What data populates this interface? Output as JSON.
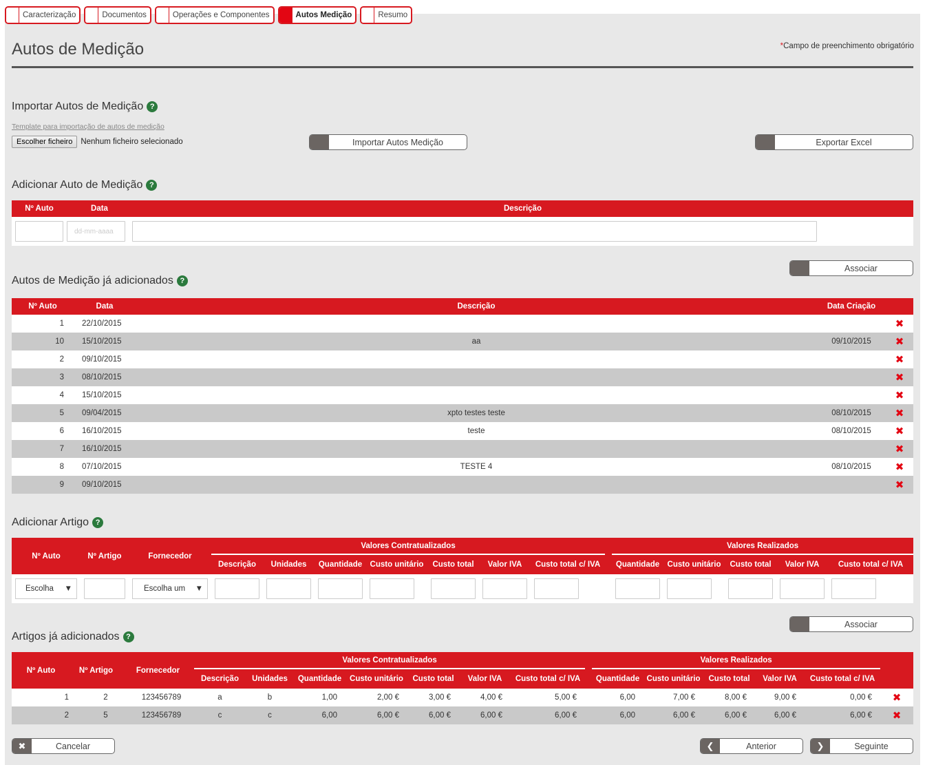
{
  "tabs": [
    {
      "label": "Caracterização",
      "active": false
    },
    {
      "label": "Documentos",
      "active": false
    },
    {
      "label": "Operações e Componentes",
      "active": false
    },
    {
      "label": "Autos Medição",
      "active": true
    },
    {
      "label": "Resumo",
      "active": false
    }
  ],
  "page": {
    "title": "Autos de Medição",
    "required_star": "*",
    "required_note": "Campo de preenchimento obrigatório"
  },
  "import": {
    "title": "Importar Autos de Medição",
    "template_link": "Template para importação de autos de medição",
    "file_button": "Escolher ficheiro",
    "file_status": "Nenhum ficheiro selecionado",
    "import_button": "Importar Autos Medição",
    "export_button": "Exportar Excel"
  },
  "add_auto": {
    "title": "Adicionar Auto de Medição",
    "headers": [
      "Nº Auto",
      "Data",
      "Descrição"
    ],
    "date_placeholder": "dd-mm-aaaa"
  },
  "autos": {
    "title": "Autos de Medição já adicionados",
    "associate_button": "Associar",
    "headers": [
      "Nº Auto",
      "Data",
      "Descrição",
      "Data Criação"
    ],
    "rows": [
      {
        "n": "1",
        "data": "22/10/2015",
        "desc": "",
        "criacao": ""
      },
      {
        "n": "10",
        "data": "15/10/2015",
        "desc": "aa",
        "criacao": "09/10/2015"
      },
      {
        "n": "2",
        "data": "09/10/2015",
        "desc": "",
        "criacao": ""
      },
      {
        "n": "3",
        "data": "08/10/2015",
        "desc": "",
        "criacao": ""
      },
      {
        "n": "4",
        "data": "15/10/2015",
        "desc": "",
        "criacao": ""
      },
      {
        "n": "5",
        "data": "09/04/2015",
        "desc": "xpto testes teste",
        "criacao": "08/10/2015"
      },
      {
        "n": "6",
        "data": "16/10/2015",
        "desc": "teste",
        "criacao": "08/10/2015"
      },
      {
        "n": "7",
        "data": "16/10/2015",
        "desc": "",
        "criacao": ""
      },
      {
        "n": "8",
        "data": "07/10/2015",
        "desc": "TESTE 4",
        "criacao": "08/10/2015"
      },
      {
        "n": "9",
        "data": "09/10/2015",
        "desc": "",
        "criacao": ""
      }
    ],
    "delete_glyph": "✖"
  },
  "add_artigo": {
    "title": "Adicionar Artigo",
    "group_contract": "Valores Contratualizados",
    "group_realized": "Valores Realizados",
    "headers_main": [
      "Nº Auto",
      "Nº Artigo",
      "Fornecedor"
    ],
    "headers_contract": [
      "Descrição",
      "Unidades",
      "Quantidade",
      "Custo unitário",
      "Custo total",
      "Valor IVA",
      "Custo total c/ IVA"
    ],
    "headers_realized": [
      "Quantidade",
      "Custo unitário",
      "Custo total",
      "Valor IVA",
      "Custo total c/ IVA"
    ],
    "select_auto": "Escolha",
    "select_fornecedor": "Escolha um"
  },
  "artigos": {
    "title": "Artigos já adicionados",
    "associate_button": "Associar",
    "group_contract": "Valores Contratualizados",
    "group_realized": "Valores Realizados",
    "headers_main": [
      "Nº Auto",
      "Nº Artigo",
      "Fornecedor"
    ],
    "headers_contract": [
      "Descrição",
      "Unidades",
      "Quantidade",
      "Custo unitário",
      "Custo total",
      "Valor IVA",
      "Custo total c/ IVA"
    ],
    "headers_realized": [
      "Quantidade",
      "Custo unitário",
      "Custo total",
      "Valor IVA",
      "Custo total c/ IVA"
    ],
    "rows": [
      {
        "auto": "1",
        "artigo": "2",
        "fornecedor": "123456789",
        "c": [
          "a",
          "b",
          "1,00",
          "2,00 €",
          "3,00 €",
          "4,00 €",
          "5,00 €"
        ],
        "r": [
          "6,00",
          "7,00 €",
          "8,00 €",
          "9,00 €",
          "0,00 €"
        ]
      },
      {
        "auto": "2",
        "artigo": "5",
        "fornecedor": "123456789",
        "c": [
          "c",
          "c",
          "6,00",
          "6,00 €",
          "6,00 €",
          "6,00 €",
          "6,00 €"
        ],
        "r": [
          "6,00",
          "6,00 €",
          "6,00 €",
          "6,00 €",
          "6,00 €"
        ]
      }
    ],
    "delete_glyph": "✖"
  },
  "footer": {
    "cancel": "Cancelar",
    "previous": "Anterior",
    "next": "Seguinte"
  },
  "colors": {
    "accent": "#d71920",
    "help": "#2b7a3d",
    "button_icon": "#6b6562",
    "background": "#e8e8e8"
  }
}
